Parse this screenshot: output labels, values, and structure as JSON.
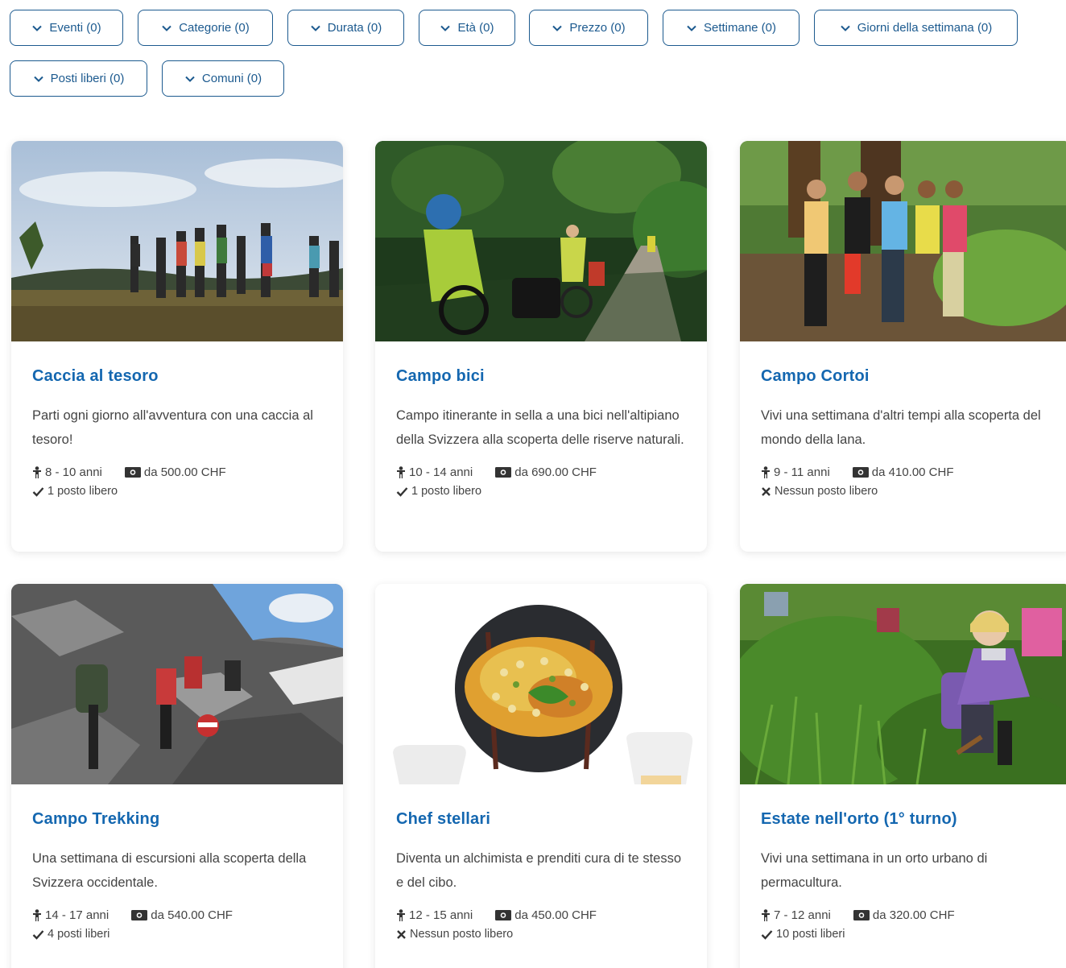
{
  "filters": [
    {
      "label": "Eventi (0)"
    },
    {
      "label": "Categorie (0)"
    },
    {
      "label": "Durata (0)"
    },
    {
      "label": "Età (0)"
    },
    {
      "label": "Prezzo (0)"
    },
    {
      "label": "Settimane (0)"
    },
    {
      "label": "Giorni della settimana (0)"
    },
    {
      "label": "Posti liberi (0)"
    },
    {
      "label": "Comuni (0)"
    }
  ],
  "cards": [
    {
      "title": "Caccia al tesoro",
      "desc": "Parti ogni giorno all'avventura con una caccia al tesoro!",
      "age": "8 - 10 anni",
      "price": "da 500.00 CHF",
      "availability": "1 posto libero",
      "available": true
    },
    {
      "title": "Campo bici",
      "desc": "Campo itinerante in sella a una bici nell'altipiano della Svizzera alla scoperta delle riserve naturali.",
      "age": "10 - 14 anni",
      "price": "da 690.00 CHF",
      "availability": "1 posto libero",
      "available": true
    },
    {
      "title": "Campo Cortoi",
      "desc": "Vivi una settimana d'altri tempi alla scoperta del mondo della lana.",
      "age": "9 - 11 anni",
      "price": "da 410.00 CHF",
      "availability": "Nessun posto libero",
      "available": false
    },
    {
      "title": "Campo Trekking",
      "desc": "Una settimana di escursioni alla scoperta della Svizzera occidentale.",
      "age": "14 - 17 anni",
      "price": "da 540.00 CHF",
      "availability": "4 posti liberi",
      "available": true
    },
    {
      "title": "Chef stellari",
      "desc": "Diventa un alchimista e prenditi cura di te stesso e del cibo.",
      "age": "12 - 15 anni",
      "price": "da 450.00 CHF",
      "availability": "Nessun posto libero",
      "available": false
    },
    {
      "title": "Estate nell'orto (1° turno)",
      "desc": "Vivi una settimana in un orto urbano di permacultura.",
      "age": "7 - 12 anni",
      "price": "da 320.00 CHF",
      "availability": "10 posti liberi",
      "available": true
    }
  ],
  "colors": {
    "accent": "#1c5a8f",
    "title": "#1467b0"
  }
}
